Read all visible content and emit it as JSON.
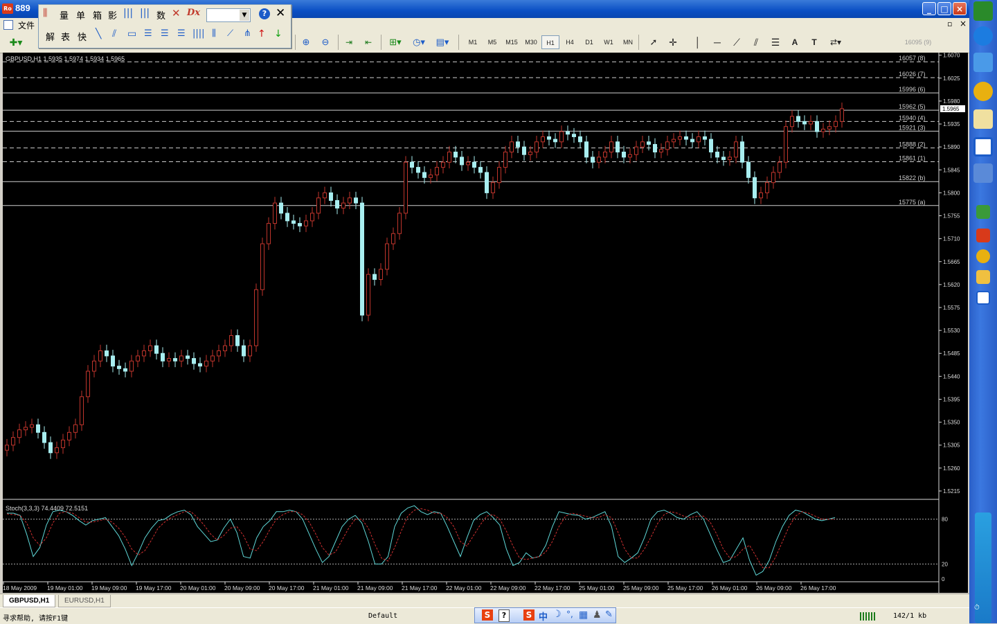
{
  "window": {
    "title": "889",
    "close": "×",
    "max": "□",
    "min": "_"
  },
  "menu": {
    "file": "文件"
  },
  "floatbar": {
    "items": [
      "量",
      "单",
      "箱",
      "影",
      "数",
      "解",
      "表",
      "快"
    ],
    "dropdown_value": ""
  },
  "toolbar": {
    "timeframes": [
      "M1",
      "M5",
      "M15",
      "M30",
      "H1",
      "H4",
      "D1",
      "W1",
      "MN"
    ],
    "active_timeframe": "H1",
    "top_right_price": "16095 (9)"
  },
  "chart": {
    "header": "GBPUSD,H1  1.5935 1.5974 1.5934 1.5965",
    "current_price_label": "1.5965",
    "price_axis": [
      "1.6070",
      "1.6025",
      "1.5980",
      "1.5935",
      "1.5890",
      "1.5845",
      "1.5800",
      "1.5755",
      "1.5710",
      "1.5665",
      "1.5620",
      "1.5575",
      "1.5530",
      "1.5485",
      "1.5440",
      "1.5395",
      "1.5350",
      "1.5305",
      "1.5260",
      "1.5215"
    ],
    "levels": [
      {
        "label": "16057 (8)",
        "price": 1.6057,
        "style": "dash"
      },
      {
        "label": "16026 (7)",
        "price": 1.6026,
        "style": "dash"
      },
      {
        "label": "15996 (6)",
        "price": 1.5996,
        "style": "solid"
      },
      {
        "label": "15962 (5)",
        "price": 1.5962,
        "style": "solid"
      },
      {
        "label": "15940 (4)",
        "price": 1.594,
        "style": "dash"
      },
      {
        "label": "15921 (3)",
        "price": 1.5921,
        "style": "solid"
      },
      {
        "label": "15888 (2)",
        "price": 1.5888,
        "style": "dash"
      },
      {
        "label": "15861 (1)",
        "price": 1.5861,
        "style": "dash"
      },
      {
        "label": "15822 (b)",
        "price": 1.5822,
        "style": "solid"
      },
      {
        "label": "15775 (a)",
        "price": 1.5775,
        "style": "solid"
      }
    ],
    "time_axis": [
      "18 May 2009",
      "19 May 01:00",
      "19 May 09:00",
      "19 May 17:00",
      "20 May 01:00",
      "20 May 09:00",
      "20 May 17:00",
      "21 May 01:00",
      "21 May 09:00",
      "21 May 17:00",
      "22 May 01:00",
      "22 May 09:00",
      "22 May 17:00",
      "25 May 01:00",
      "25 May 09:00",
      "25 May 17:00",
      "26 May 01:00",
      "26 May 09:00",
      "26 May 17:00"
    ],
    "stoch_label": "Stoch(3,3,3) 74.4409 72.5151",
    "stoch_axis": [
      "80",
      "20",
      "0"
    ]
  },
  "chart_data": {
    "type": "candlestick",
    "symbol": "GBPUSD",
    "timeframe": "H1",
    "ylim": [
      1.52,
      1.6075
    ],
    "closes": [
      1.5305,
      1.532,
      1.5335,
      1.534,
      1.5345,
      1.533,
      1.531,
      1.529,
      1.53,
      1.5315,
      1.533,
      1.5345,
      1.54,
      1.545,
      1.547,
      1.549,
      1.548,
      1.546,
      1.5455,
      1.545,
      1.547,
      1.548,
      1.549,
      1.55,
      1.5485,
      1.547,
      1.5475,
      1.547,
      1.548,
      1.5475,
      1.5465,
      1.546,
      1.547,
      1.548,
      1.549,
      1.55,
      1.552,
      1.55,
      1.548,
      1.55,
      1.561,
      1.57,
      1.574,
      1.578,
      1.576,
      1.5745,
      1.574,
      1.5735,
      1.5745,
      1.576,
      1.579,
      1.58,
      1.5785,
      1.577,
      1.578,
      1.579,
      1.578,
      1.556,
      1.564,
      1.563,
      1.565,
      1.57,
      1.572,
      1.576,
      1.586,
      1.585,
      1.584,
      1.583,
      1.5835,
      1.585,
      1.586,
      1.588,
      1.587,
      1.5855,
      1.586,
      1.585,
      1.584,
      1.58,
      1.582,
      1.585,
      1.588,
      1.59,
      1.589,
      1.5875,
      1.588,
      1.59,
      1.591,
      1.5905,
      1.59,
      1.592,
      1.5915,
      1.591,
      1.59,
      1.587,
      1.586,
      1.587,
      1.588,
      1.59,
      1.588,
      1.587,
      1.5875,
      1.589,
      1.59,
      1.5895,
      1.588,
      1.5885,
      1.59,
      1.5905,
      1.591,
      1.5905,
      1.59,
      1.591,
      1.5905,
      1.588,
      1.587,
      1.5865,
      1.587,
      1.59,
      1.586,
      1.583,
      1.579,
      1.58,
      1.582,
      1.584,
      1.586,
      1.593,
      1.595,
      1.594,
      1.5935,
      1.594,
      1.592,
      1.5925,
      1.593,
      1.594,
      1.5965
    ],
    "stoch_k": [
      88,
      88,
      85,
      60,
      30,
      42,
      72,
      90,
      92,
      90,
      85,
      78,
      72,
      78,
      80,
      82,
      70,
      58,
      40,
      18,
      35,
      55,
      68,
      78,
      80,
      86,
      90,
      92,
      86,
      70,
      60,
      50,
      52,
      68,
      80,
      62,
      30,
      28,
      55,
      70,
      78,
      90,
      90,
      92,
      90,
      80,
      60,
      40,
      22,
      30,
      50,
      70,
      80,
      85,
      75,
      50,
      20,
      20,
      30,
      70,
      88,
      95,
      98,
      90,
      86,
      90,
      88,
      70,
      50,
      30,
      55,
      78,
      86,
      90,
      82,
      72,
      40,
      18,
      22,
      35,
      28,
      30,
      45,
      70,
      90,
      88,
      86,
      85,
      80,
      82,
      86,
      90,
      70,
      30,
      22,
      28,
      35,
      55,
      80,
      90,
      92,
      88,
      82,
      80,
      86,
      90,
      80,
      60,
      40,
      22,
      25,
      40,
      55,
      25,
      5,
      10,
      25,
      50,
      70,
      85,
      92,
      90,
      85,
      80,
      78,
      80,
      82
    ],
    "stoch_d": [
      87,
      86,
      85,
      75,
      55,
      45,
      55,
      75,
      88,
      90,
      88,
      82,
      76,
      76,
      78,
      80,
      76,
      68,
      56,
      40,
      32,
      38,
      52,
      68,
      76,
      82,
      86,
      90,
      90,
      82,
      72,
      60,
      52,
      58,
      68,
      70,
      58,
      40,
      38,
      50,
      66,
      80,
      86,
      90,
      90,
      86,
      76,
      60,
      42,
      32,
      36,
      52,
      68,
      80,
      80,
      68,
      46,
      28,
      24,
      42,
      64,
      84,
      92,
      94,
      92,
      88,
      88,
      82,
      70,
      50,
      44,
      58,
      72,
      84,
      86,
      80,
      64,
      44,
      28,
      26,
      28,
      30,
      36,
      50,
      70,
      84,
      88,
      86,
      84,
      82,
      82,
      86,
      82,
      62,
      40,
      28,
      28,
      40,
      56,
      74,
      86,
      90,
      88,
      84,
      82,
      84,
      84,
      76,
      60,
      40,
      28,
      30,
      40,
      45,
      30,
      15,
      15,
      30,
      50,
      70,
      84,
      90,
      88,
      84,
      80,
      80,
      80
    ]
  }
}
